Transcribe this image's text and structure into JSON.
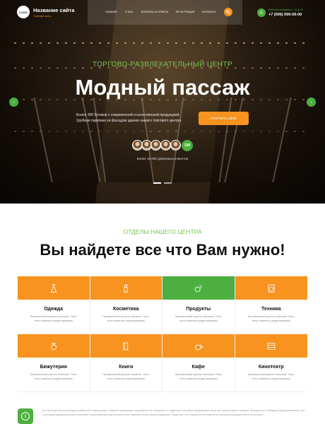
{
  "header": {
    "logo_text": "LOGO",
    "site_title": "Название сайта",
    "site_subtitle": "Торговый центр",
    "nav": [
      "Главная",
      "О нас",
      "Вопросы и ответы",
      "Регистрация",
      "Контакты"
    ],
    "phone_label": "Работаем ежедневно с 10 до 22",
    "phone_number": "+7 (000) 000-00-00"
  },
  "hero": {
    "subtitle": "ТОРГОВО-РАЗВЛЕКАТЕЛЬНЫЙ ЦЕНТР",
    "title": "Модный пассаж",
    "description_line1": "Более 300 бутиков с современной и качественной продукцией.",
    "description_line2": "Удобная парковка за фасадом здания нашего торгового центра",
    "cta_label": "ПОЛУЧИТЬ СВОЕ",
    "visitors_badge": "10К",
    "visitors_text": "Более 10 000 довольных клиентов"
  },
  "section": {
    "subtitle": "ОТДЕЛЫ НАШЕГО ЦЕНТРА",
    "title": "Вы найдете все что Вам нужно!"
  },
  "departments": [
    {
      "name": "Одежда",
      "desc": "Произвольный краткое описание. Текст легко изменить редактирования",
      "icon": "dress-icon"
    },
    {
      "name": "Косметика",
      "desc": "Произвольный краткое описание. Текст легко изменить редактирования",
      "icon": "cosmetics-icon"
    },
    {
      "name": "Продукты",
      "desc": "Произвольный краткое описание. Текст легко изменить редактирования",
      "icon": "grocery-icon"
    },
    {
      "name": "Техника",
      "desc": "Произвольный краткое описание. Текст легко изменить редактирования",
      "icon": "appliance-icon"
    },
    {
      "name": "Бижутерия",
      "desc": "Произвольный краткое описание. Текст легко изменить редактирования",
      "icon": "jewelry-icon"
    },
    {
      "name": "Книги",
      "desc": "Произвольный краткое описание. Текст легко изменить редактирования",
      "icon": "books-icon"
    },
    {
      "name": "Кафе",
      "desc": "Произвольный краткое описание. Текст легко изменить редактирования",
      "icon": "coffee-icon"
    },
    {
      "name": "Кинотеатр",
      "desc": "Произвольный краткое описание. Текст легко изменить редактирования",
      "icon": "cinema-icon"
    }
  ],
  "note": {
    "text": "В этом блоке мы рекомендуем разместить информацию о Вашей организации, подчеркнуть ее значимость и надежность на рынке оказываемых услуг или предлагаемых товаров. Произвольно. Обладая Вашим вниманием, этот текстовый информационный блок имеет стилизованный вид, который легко изменить через панель редактора. Убедитесь, что сохранили все изменения перед публикацией сайта на хостинге."
  },
  "colors": {
    "accent_orange": "#f7931e",
    "accent_green": "#4caf3f"
  }
}
